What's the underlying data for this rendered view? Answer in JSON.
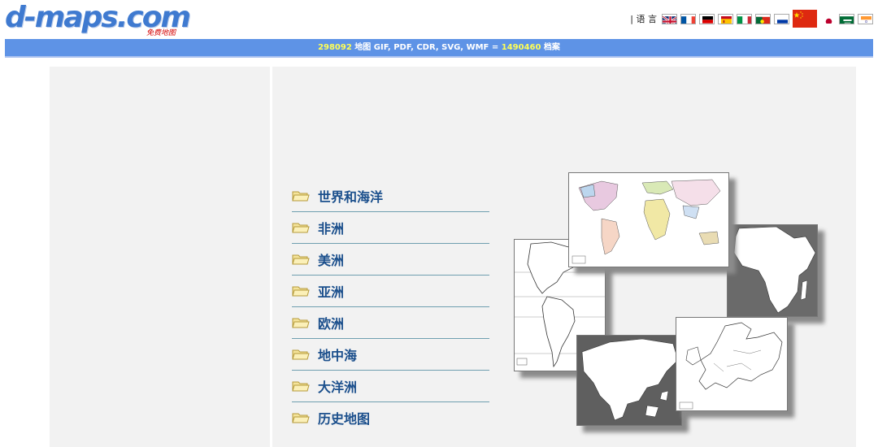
{
  "site": {
    "logo_text": "d-maps.com",
    "logo_sub": "免费地图"
  },
  "language": {
    "label": "| 语 言",
    "flags": [
      "en",
      "fr",
      "de",
      "es",
      "it",
      "pt",
      "ru",
      "cn",
      "jp",
      "sa",
      "in"
    ]
  },
  "banner": {
    "maps_count": "298092",
    "middle": " 地图 GIF, PDF, CDR, SVG, WMF = ",
    "files_count": "1490460",
    "suffix": " 档案"
  },
  "menu": {
    "items": [
      {
        "label": "世界和海洋"
      },
      {
        "label": "非洲"
      },
      {
        "label": "美洲"
      },
      {
        "label": "亚洲"
      },
      {
        "label": "欧洲"
      },
      {
        "label": "地中海"
      },
      {
        "label": "大洋洲"
      },
      {
        "label": "历史地图"
      }
    ]
  },
  "collage": {
    "maps": [
      "world-map",
      "africa-map",
      "americas-map",
      "asia-map",
      "europe-map"
    ]
  },
  "colors": {
    "banner": "#5e93e6",
    "banner_number": "#ffff55",
    "menu_text": "#1b4f8c",
    "panel": "#f2f2f2",
    "logo": "#3f7ad0"
  }
}
